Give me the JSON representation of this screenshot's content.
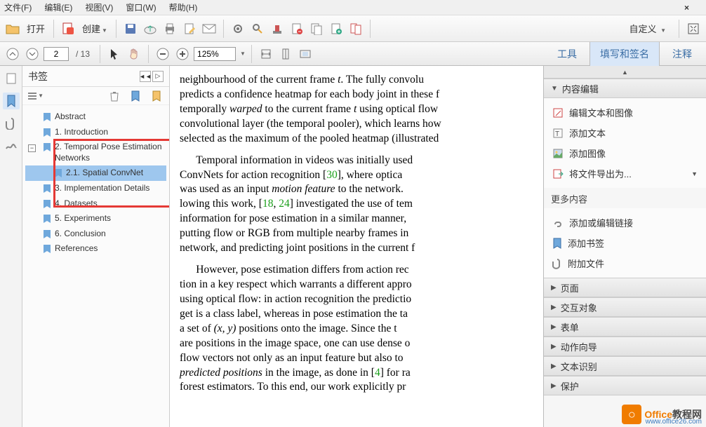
{
  "menu": {
    "file": "文件(F)",
    "edit": "编辑(E)",
    "view": "视图(V)",
    "window": "窗口(W)",
    "help": "帮助(H)",
    "close": "×"
  },
  "toolbar": {
    "open": "打开",
    "create": "创建",
    "custom": "自定义"
  },
  "nav": {
    "page": "2",
    "total": "/ 13",
    "zoom": "125%"
  },
  "tooltabs": {
    "tools": "工具",
    "fillsign": "填写和签名",
    "comment": "注释"
  },
  "bookmarks": {
    "title": "书签",
    "items": [
      {
        "label": "Abstract"
      },
      {
        "label": "1. Introduction"
      },
      {
        "label": "2. Temporal Pose Estimation Networks"
      },
      {
        "label": "2.1. Spatial ConvNet"
      },
      {
        "label": "3. Implementation Details"
      },
      {
        "label": "4. Datasets"
      },
      {
        "label": "5. Experiments"
      },
      {
        "label": "6. Conclusion"
      },
      {
        "label": "References"
      }
    ]
  },
  "doc": {
    "p1a": "neighbourhood of the current frame ",
    "p1b": ". The fully convolu",
    "p2": "predicts a confidence heatmap for each body joint in these f",
    "p3a": "temporally ",
    "p3b": "warped",
    "p3c": " to the current frame ",
    "p3d": " using optical flow",
    "p4": "convolutional layer (the temporal pooler), which learns how",
    "p5": "selected as the maximum of the pooled heatmap (illustrated",
    "p6a": "Temporal information in videos was initially used",
    "p6b": "ConvNets for action recognition [",
    "c30": "30",
    "p6c": "], where optica",
    "p6d": "was used as an input ",
    "mf": "motion feature",
    "p6e": " to the network.",
    "p6f": "lowing this work, [",
    "c18": "18",
    "csep": ", ",
    "c24": "24",
    "p6g": "] investigated the use of tem",
    "p6h": "information for pose estimation in a similar manner,",
    "p6i": "putting flow or RGB from multiple nearby frames in",
    "p6j": "network, and predicting joint positions in the current f",
    "p7a": "However, pose estimation differs from action rec",
    "p7b": "tion in a key respect which warrants a different appro",
    "p7c": "using optical flow: in action recognition the predictio",
    "p7d": "get is a class label, whereas in pose estimation the ta",
    "p7e": "a set of ",
    "xy": "(x, y)",
    "p7f": " positions onto the image. Since the t",
    "p7g": "are positions in the image space, one can use dense o",
    "p7h": "flow vectors not only as an input feature but also to",
    "pp": "predicted positions",
    "p7i": " in the image, as done in [",
    "c4": "4",
    "p7j": "] for ra",
    "p7k": "forest estimators. To this end, our work explicitly pr"
  },
  "rightpanel": {
    "content_edit": "内容编辑",
    "edit_text_image": "编辑文本和图像",
    "add_text": "添加文本",
    "add_image": "添加图像",
    "export_as": "将文件导出为...",
    "more_content": "更多内容",
    "add_link": "添加或编辑链接",
    "add_bookmark": "添加书签",
    "attach_file": "附加文件",
    "page": "页面",
    "interactive": "交互对象",
    "form": "表单",
    "action_wizard": "动作向导",
    "text_recognition": "文本识别",
    "protect": "保护"
  },
  "watermark": {
    "brand1": "Office",
    "brand2": "教程网",
    "url": "www.office26.com"
  }
}
